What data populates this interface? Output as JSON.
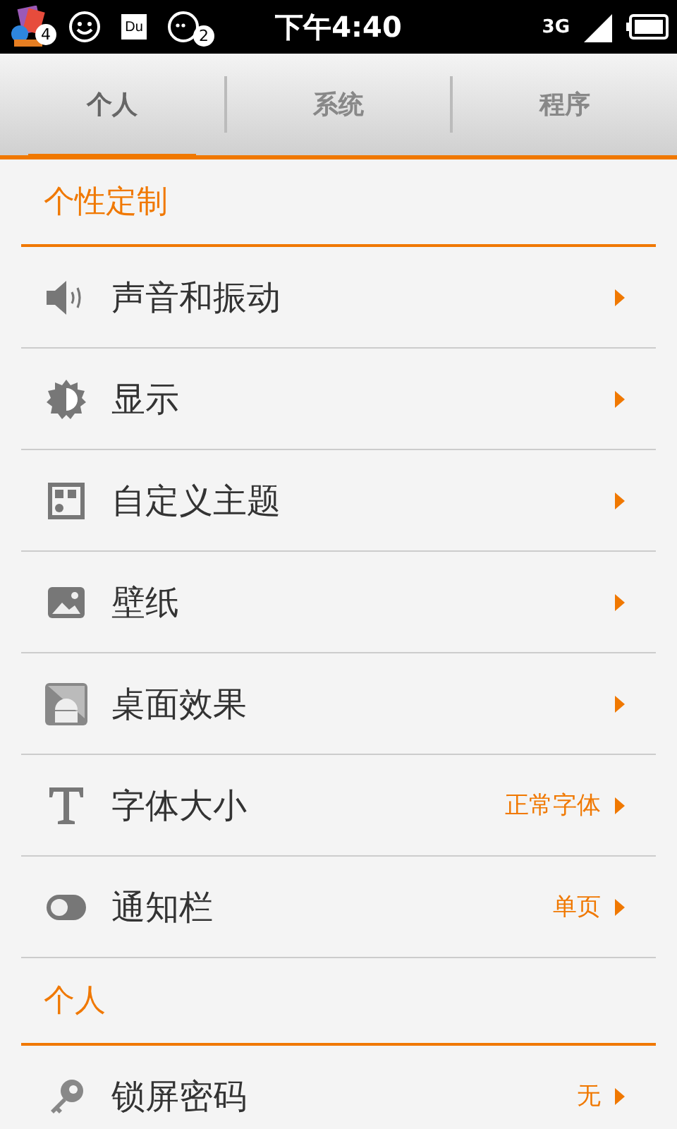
{
  "status_bar": {
    "notifications": [
      {
        "kind": "app",
        "badge": "4"
      },
      {
        "kind": "smiley"
      },
      {
        "kind": "du",
        "text": "Du"
      },
      {
        "kind": "chat",
        "badge": "2"
      }
    ],
    "time": "下午4:40",
    "network": "3G"
  },
  "tabs": [
    {
      "label": "个人",
      "selected": true
    },
    {
      "label": "系统",
      "selected": false
    },
    {
      "label": "程序",
      "selected": false
    }
  ],
  "sections": [
    {
      "title": "个性定制",
      "items": [
        {
          "kind": "sound",
          "label": "声音和振动"
        },
        {
          "kind": "display",
          "label": "显示"
        },
        {
          "kind": "theme",
          "label": "自定义主题"
        },
        {
          "kind": "wallpaper",
          "label": "壁纸"
        },
        {
          "kind": "desktop",
          "label": "桌面效果"
        },
        {
          "kind": "font",
          "label": "字体大小",
          "value": "正常字体"
        },
        {
          "kind": "toggle",
          "label": "通知栏",
          "value": "单页"
        }
      ]
    },
    {
      "title": "个人",
      "items": [
        {
          "kind": "key",
          "label": "锁屏密码",
          "value": "无"
        }
      ]
    }
  ]
}
